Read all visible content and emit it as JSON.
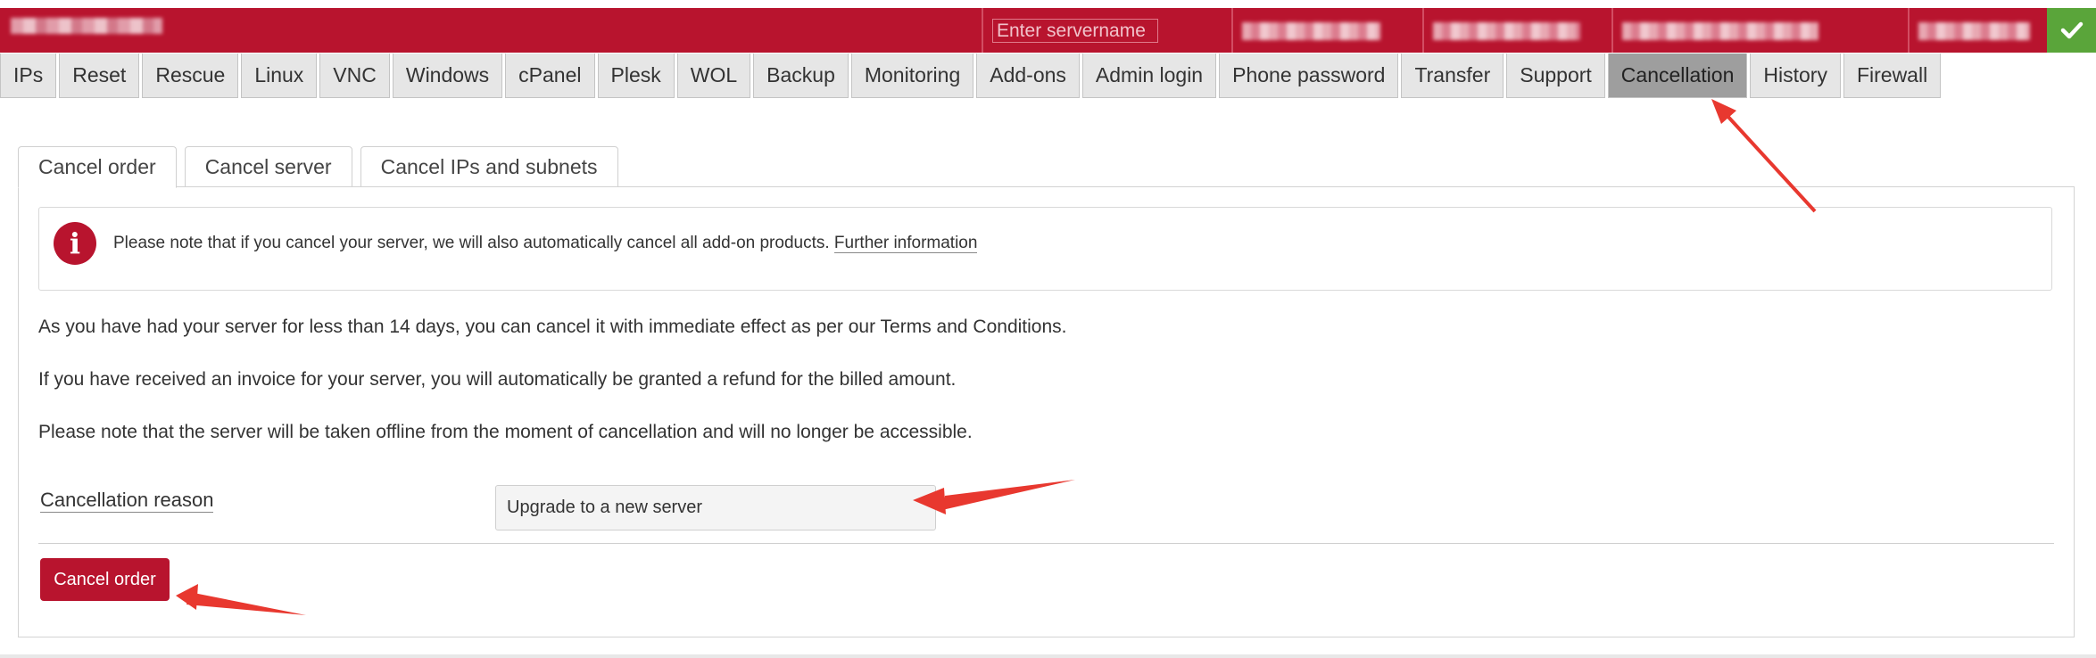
{
  "header": {
    "search": {
      "placeholder": "Enter servername"
    },
    "colors": {
      "brand": "#b8142e",
      "confirm": "#5aa53a",
      "active_tab": "#9e9e9e",
      "annotation": "#e8382f"
    },
    "icons": {
      "confirm": "checkmark-icon"
    }
  },
  "nav": {
    "tabs": [
      {
        "label": "IPs"
      },
      {
        "label": "Reset"
      },
      {
        "label": "Rescue"
      },
      {
        "label": "Linux"
      },
      {
        "label": "VNC"
      },
      {
        "label": "Windows"
      },
      {
        "label": "cPanel"
      },
      {
        "label": "Plesk"
      },
      {
        "label": "WOL"
      },
      {
        "label": "Backup"
      },
      {
        "label": "Monitoring"
      },
      {
        "label": "Add-ons"
      },
      {
        "label": "Admin login"
      },
      {
        "label": "Phone password"
      },
      {
        "label": "Transfer"
      },
      {
        "label": "Support"
      },
      {
        "label": "Cancellation",
        "active": true
      },
      {
        "label": "History"
      },
      {
        "label": "Firewall"
      }
    ]
  },
  "subtabs": [
    {
      "label": "Cancel order",
      "active": true
    },
    {
      "label": "Cancel server"
    },
    {
      "label": "Cancel IPs and subnets"
    }
  ],
  "notice": {
    "icon": "info-icon",
    "text": "Please note that if you cancel your server, we will also automatically cancel all add-on products.",
    "link": "Further information"
  },
  "paragraphs": [
    "As you have had your server for less than 14 days, you can cancel it with immediate effect as per our Terms and Conditions.",
    "If you have received an invoice for your server, you will automatically be granted a refund for the billed amount.",
    "Please note that the server will be taken offline from the moment of cancellation and will no longer be accessible."
  ],
  "form": {
    "reason_label": "Cancellation reason",
    "reason_value": "Upgrade to a new server",
    "submit_label": "Cancel order"
  }
}
